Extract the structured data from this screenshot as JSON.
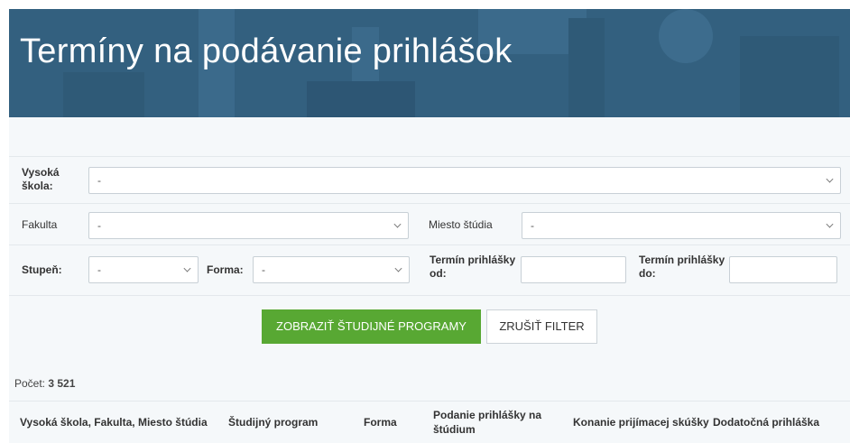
{
  "header": {
    "title": "Termíny na podávanie prihlášok"
  },
  "filters": {
    "vysoka_skola": {
      "label": "Vysoká škola:",
      "value": "-"
    },
    "fakulta": {
      "label": "Fakulta",
      "value": "-"
    },
    "miesto_studia": {
      "label": "Miesto štúdia",
      "value": "-"
    },
    "stupen": {
      "label": "Stupeň:",
      "value": "-"
    },
    "forma": {
      "label": "Forma:",
      "value": "-"
    },
    "termin_od": {
      "label": "Termín prihlášky od:",
      "value": ""
    },
    "termin_do": {
      "label": "Termín prihlášky do:",
      "value": ""
    }
  },
  "buttons": {
    "show": "ZOBRAZIŤ ŠTUDIJNÉ PROGRAMY",
    "clear": "ZRUŠIŤ FILTER"
  },
  "count": {
    "label": "Počet:",
    "value": "3 521"
  },
  "table": {
    "columns": [
      "Vysoká škola, Fakulta, Miesto štúdia",
      "Študijný program",
      "Forma",
      "Podanie prihlášky na štúdium",
      "Konanie prijímacej skúšky",
      "Dodatočná prihláška"
    ]
  },
  "colors": {
    "banner": "#33607f",
    "primary_button": "#58a833",
    "background": "#f5f8fa"
  }
}
